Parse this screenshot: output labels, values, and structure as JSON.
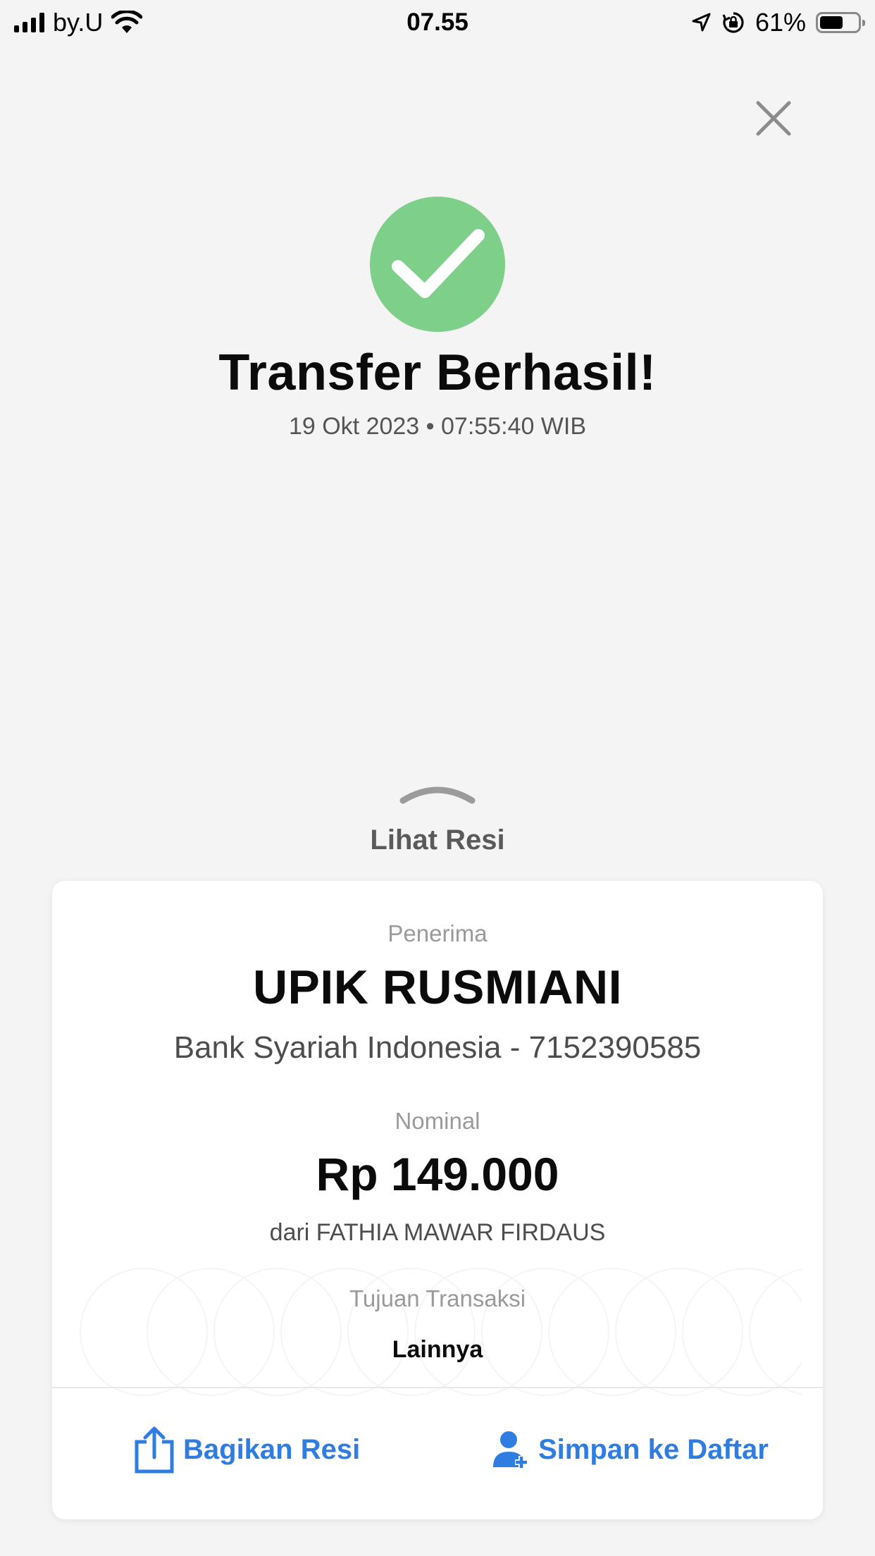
{
  "status_bar": {
    "carrier": "by.U",
    "time": "07.55",
    "battery": "61%"
  },
  "header": {
    "close_icon": "close-icon",
    "status_icon": "check-icon",
    "status_color": "#7dcf8a",
    "title": "Transfer Berhasil!",
    "datetime": "19 Okt 2023 • 07:55:40 WIB"
  },
  "receipt_toggle": {
    "label": "Lihat Resi"
  },
  "receipt": {
    "recipient_label": "Penerima",
    "recipient_name": "UPIK RUSMIANI",
    "recipient_bank": "Bank Syariah Indonesia - 7152390585",
    "amount_label": "Nominal",
    "amount": "Rp 149.000",
    "sender": "dari FATHIA MAWAR FIRDAUS",
    "purpose_label": "Tujuan Transaksi",
    "purpose": "Lainnya"
  },
  "actions": {
    "share_label": "Bagikan Resi",
    "save_label": "Simpan ke Daftar",
    "accent_color": "#2f7de1"
  }
}
